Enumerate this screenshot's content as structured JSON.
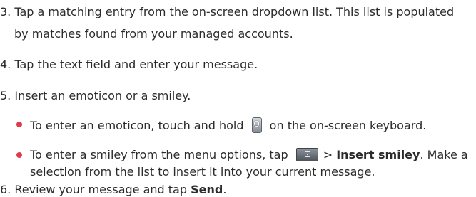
{
  "content": {
    "step3": {
      "line1": "3. Tap a matching entry from the on-screen dropdown list. This list is populated",
      "line2": "by matches found from your managed accounts."
    },
    "step4": {
      "text": "4. Tap the text field and enter your message."
    },
    "step5": {
      "text": "5. Insert an emoticon or a smiley."
    },
    "bullet1": {
      "before": "To enter an emoticon, touch and hold ",
      "icon_label": "Q",
      "after": " on the on-screen keyboard."
    },
    "bullet2": {
      "before": "To enter a smiley from the menu options, tap ",
      "arrow": "> ",
      "bold": "Insert smiley",
      "after": ". Make a",
      "line2": "selection from the list to insert it into your current message."
    },
    "step6": {
      "before": "6. Review your message and tap ",
      "bold": "Send",
      "after": "."
    }
  },
  "colors": {
    "text": "#2b2b2b",
    "bullet": "#e03a4b"
  },
  "icons": {
    "keyboard_key": "q-key-icon",
    "menu": "menu-icon"
  }
}
